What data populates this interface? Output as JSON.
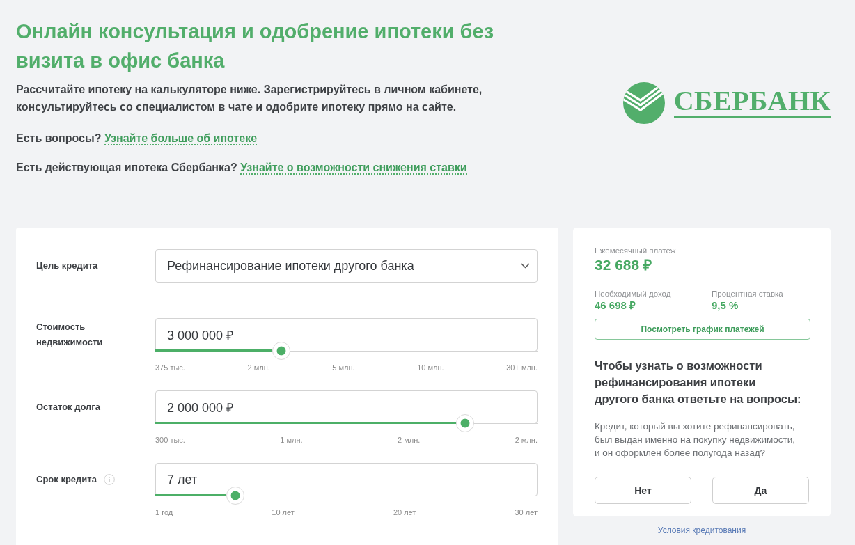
{
  "header": {
    "title": "Онлайн консультация и одобрение ипотеки без визита в офис банка",
    "intro": "Рассчитайте ипотеку на калькуляторе ниже. Зарегистрируйтесь в личном кабинете, консультируйтесь со специалистом в чате и одобрите ипотеку прямо на сайте.",
    "prompts": [
      {
        "question": "Есть вопросы?",
        "link": "Узнайте больше об ипотеке"
      },
      {
        "question": "Есть действующая ипотека Сбербанка?",
        "link": "Узнайте о возможности снижения ставки"
      }
    ]
  },
  "logo": {
    "wordmark": "СБЕРБАНК"
  },
  "calculator": {
    "fields": [
      {
        "kind": "select",
        "label": "Цель кредита",
        "value": "Рефинансирование ипотеки другого банка",
        "info": false
      },
      {
        "kind": "slider",
        "label": "Стоимость недвижимости",
        "value": "3 000 000 ₽",
        "level": 0.33,
        "ticks": [
          "375 тыс.",
          "2 млн.",
          "5 млн.",
          "10 млн.",
          "30+ млн."
        ],
        "info": false
      },
      {
        "kind": "slider",
        "label": "Остаток долга",
        "value": "2 000 000 ₽",
        "level": 0.81,
        "ticks": [
          "300 тыс.",
          "1 млн.",
          "2 млн.",
          "2 млн."
        ],
        "info": false
      },
      {
        "kind": "slider",
        "label": "Срок кредита",
        "value": "7 лет",
        "level": 0.21,
        "ticks": [
          "1 год",
          "10 лет",
          "20 лет",
          "30 лет"
        ],
        "info": true
      }
    ]
  },
  "summary": {
    "payment": {
      "label": "Ежемесячный платеж",
      "value": "32 688 ₽"
    },
    "details": [
      {
        "label": "Необходимый доход",
        "value": "46 698 ₽"
      },
      {
        "label": "Процентная ставка",
        "value": "9,5 %"
      }
    ],
    "schedule_button": "Посмотреть график платежей",
    "question_title": "Чтобы узнать о возможности рефинансирования ипотеки другого банка ответьте на вопросы:",
    "question_text": "Кредит, который вы хотите рефинансировать, был выдан именно на покупку недвижимости, и он оформлен более полугода назад?",
    "answers": [
      "Нет",
      "Да"
    ]
  },
  "terms_link": "Условия кредитования"
}
